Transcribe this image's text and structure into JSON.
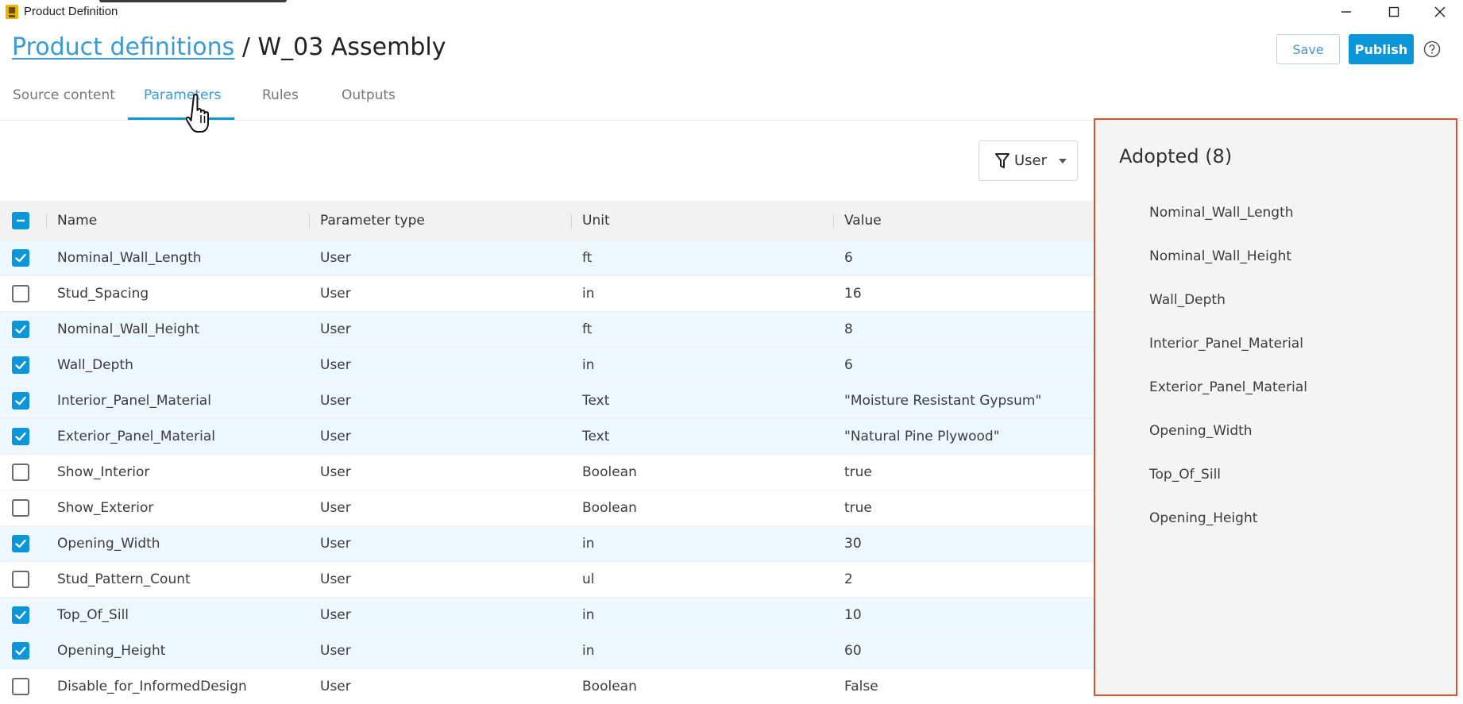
{
  "window": {
    "title": "Product Definition",
    "icon": "app-logo-icon"
  },
  "header": {
    "crumb_link": "Product definitions",
    "crumb_sep": " / ",
    "crumb_current": "W_03 Assembly",
    "save_label": "Save",
    "publish_label": "Publish"
  },
  "tabs": [
    {
      "label": "Source content",
      "active": false
    },
    {
      "label": "Parameters",
      "active": true
    },
    {
      "label": "Rules",
      "active": false
    },
    {
      "label": "Outputs",
      "active": false
    }
  ],
  "filter": {
    "label": "User"
  },
  "table": {
    "headers": {
      "name": "Name",
      "type": "Parameter type",
      "unit": "Unit",
      "value": "Value"
    },
    "rows": [
      {
        "checked": true,
        "name": "Nominal_Wall_Length",
        "type": "User",
        "unit": "ft",
        "value": "6"
      },
      {
        "checked": false,
        "name": "Stud_Spacing",
        "type": "User",
        "unit": "in",
        "value": "16"
      },
      {
        "checked": true,
        "name": "Nominal_Wall_Height",
        "type": "User",
        "unit": "ft",
        "value": "8"
      },
      {
        "checked": true,
        "name": "Wall_Depth",
        "type": "User",
        "unit": "in",
        "value": "6"
      },
      {
        "checked": true,
        "name": "Interior_Panel_Material",
        "type": "User",
        "unit": "Text",
        "value": "\"Moisture Resistant Gypsum\""
      },
      {
        "checked": true,
        "name": "Exterior_Panel_Material",
        "type": "User",
        "unit": "Text",
        "value": "\"Natural Pine Plywood\""
      },
      {
        "checked": false,
        "name": "Show_Interior",
        "type": "User",
        "unit": "Boolean",
        "value": "true"
      },
      {
        "checked": false,
        "name": "Show_Exterior",
        "type": "User",
        "unit": "Boolean",
        "value": "true"
      },
      {
        "checked": true,
        "name": "Opening_Width",
        "type": "User",
        "unit": "in",
        "value": "30"
      },
      {
        "checked": false,
        "name": "Stud_Pattern_Count",
        "type": "User",
        "unit": "ul",
        "value": "2"
      },
      {
        "checked": true,
        "name": "Top_Of_Sill",
        "type": "User",
        "unit": "in",
        "value": "10"
      },
      {
        "checked": true,
        "name": "Opening_Height",
        "type": "User",
        "unit": "in",
        "value": "60"
      },
      {
        "checked": false,
        "name": "Disable_for_InformedDesign",
        "type": "User",
        "unit": "Boolean",
        "value": "False"
      }
    ]
  },
  "adopted": {
    "title": "Adopted (8)",
    "items": [
      "Nominal_Wall_Length",
      "Nominal_Wall_Height",
      "Wall_Depth",
      "Interior_Panel_Material",
      "Exterior_Panel_Material",
      "Opening_Width",
      "Top_Of_Sill",
      "Opening_Height"
    ]
  },
  "colors": {
    "accent": "#0b96d9",
    "link": "#3a9bd5",
    "panel_border": "#e0522b",
    "selected_row": "#eef7fd"
  }
}
